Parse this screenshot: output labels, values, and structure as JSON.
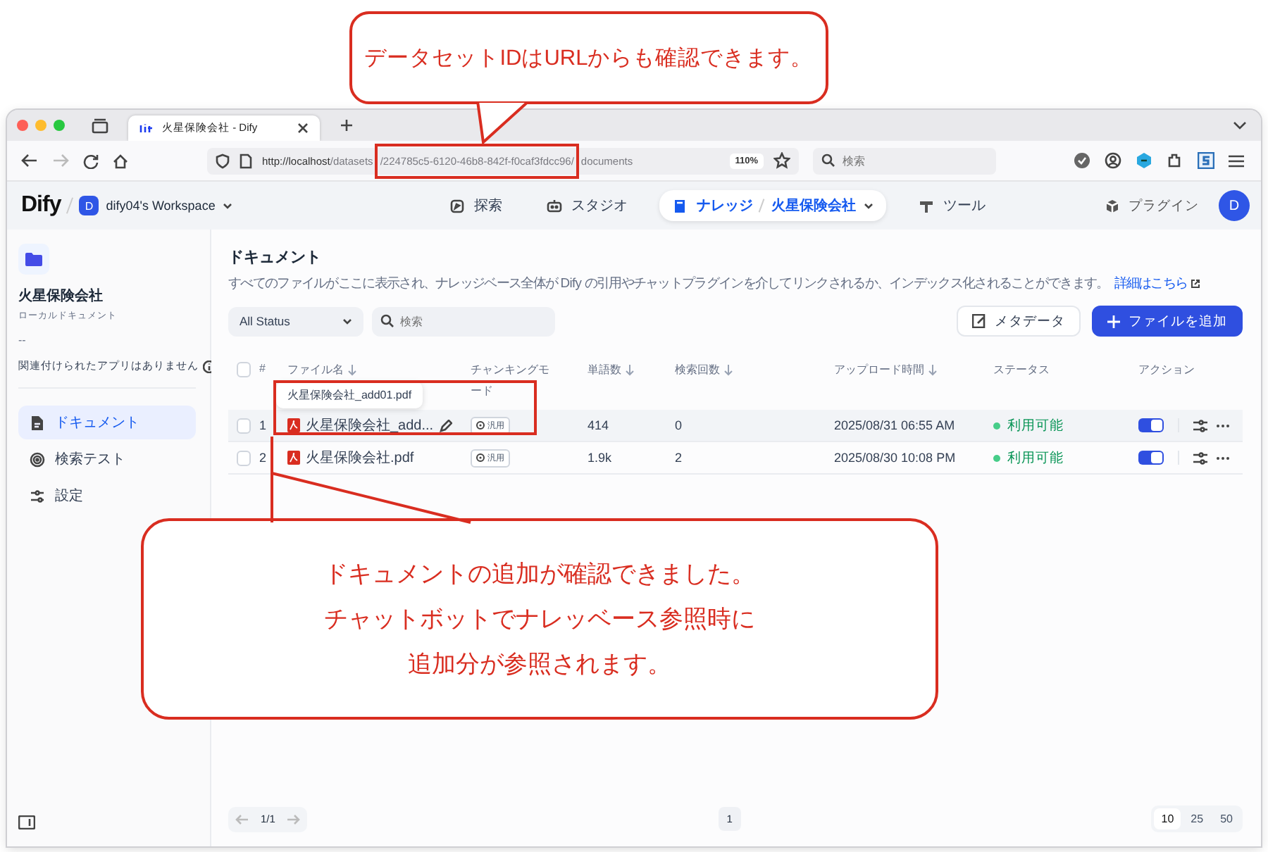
{
  "browser": {
    "tabs": [
      {
        "title": "火星保険会社 - Dify",
        "selected": true
      }
    ],
    "url": {
      "host": "http://localhost",
      "prefix": "/datasets",
      "id": "/224785c5-6120-46b8-842f-f0caf3fdcc96/",
      "suffix": "documents"
    },
    "zoom": "110%",
    "search": {
      "placeholder": "検索"
    }
  },
  "header": {
    "logo": "Dify",
    "workspace": {
      "initial": "D",
      "name": "dify04's Workspace"
    },
    "nav": [
      {
        "label": "探索",
        "kind": "explore",
        "selected": false
      },
      {
        "label": "スタジオ",
        "kind": "studio",
        "selected": false
      },
      {
        "label": "ナレッジ",
        "kind": "knowledge",
        "selected": true,
        "dataset": "火星保険会社"
      },
      {
        "label": "ツール",
        "kind": "tools",
        "selected": false
      }
    ],
    "plugins": "プラグイン",
    "avatar": "D"
  },
  "sidebar": {
    "name": "火星保険会社",
    "type": "ローカルドキュメント",
    "description": "--",
    "related": "関連付けられたアプリはありません",
    "menu": [
      {
        "label": "ドキュメント",
        "kind": "docs",
        "selected": true
      },
      {
        "label": "検索テスト",
        "kind": "test",
        "selected": false
      },
      {
        "label": "設定",
        "kind": "settings",
        "selected": false
      }
    ]
  },
  "main": {
    "title": "ドキュメント",
    "description": "すべてのファイルがここに表示され、ナレッジベース全体が Dify の引用やチャットプラグインを介してリンクされるか、インデックス化されることができます。",
    "link": "詳細はこちら",
    "filter": "All Status",
    "search": {
      "placeholder": "検索"
    },
    "metadata_button": "メタデータ",
    "add_button": "ファイルを追加",
    "table": {
      "select_all": {
        "checked": false
      },
      "columns": [
        {
          "label": "#",
          "sortable": false
        },
        {
          "label": "ファイル名",
          "sortable": true
        },
        {
          "label": "チャンキングモード",
          "sortable": false
        },
        {
          "label": "単語数",
          "sortable": true
        },
        {
          "label": "検索回数",
          "sortable": true
        },
        {
          "label": "アップロード時間",
          "sortable": true
        },
        {
          "label": "ステータス",
          "sortable": false
        },
        {
          "label": "アクション",
          "sortable": false
        }
      ],
      "rows": [
        {
          "checked": false,
          "highlighted": true,
          "no": "1",
          "name": "火星保険会社_add...",
          "mode": "汎用",
          "words": "414",
          "hits": "0",
          "uploaded": "2025/08/31 06:55 AM",
          "status": "利用可能",
          "enabled": true
        },
        {
          "checked": false,
          "highlighted": false,
          "no": "2",
          "name": "火星保険会社.pdf",
          "mode": "汎用",
          "words": "1.9k",
          "hits": "2",
          "uploaded": "2025/08/30 10:08 PM",
          "status": "利用可能",
          "enabled": true
        }
      ]
    },
    "tooltip": "火星保険会社_add01.pdf",
    "pagination": {
      "range": "1/1",
      "pages": [
        {
          "label": "1",
          "selected": true
        }
      ],
      "sizes": [
        {
          "label": "10",
          "selected": true
        },
        {
          "label": "25",
          "selected": false
        },
        {
          "label": "50",
          "selected": false
        }
      ]
    }
  },
  "callouts": [
    {
      "kind": "top",
      "lines": [
        "データセットIDはURLからも確認できます。"
      ]
    },
    {
      "kind": "bottom",
      "lines": [
        "ドキュメントの追加が確認できました。",
        "チャットボットでナレッベース参照時に",
        "追加分が参照されます。"
      ]
    }
  ]
}
